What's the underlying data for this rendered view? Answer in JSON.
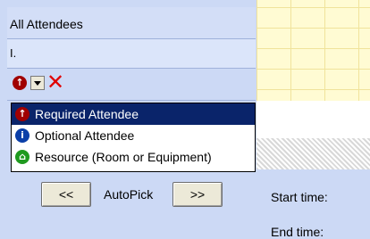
{
  "attendee_list": {
    "header": "All Attendees",
    "rows": [
      {
        "name": "I."
      }
    ]
  },
  "attendee_type_menu": {
    "items": [
      {
        "label": "Required Attendee",
        "icon": "required-attendee-icon",
        "selected": true
      },
      {
        "label": "Optional Attendee",
        "icon": "optional-attendee-icon",
        "selected": false
      },
      {
        "label": "Resource (Room or Equipment)",
        "icon": "resource-icon",
        "selected": false
      }
    ]
  },
  "autopick": {
    "prev_label": "<<",
    "label": "AutoPick",
    "next_label": ">>"
  },
  "times": {
    "start_label": "Start time:",
    "end_label": "End time:"
  },
  "colors": {
    "panel_bg": "#ccd9f5",
    "grid_bg": "#fffbd3",
    "selection": "#0a246a",
    "required": "#a00000",
    "optional": "#0b3fa8",
    "resource": "#1f9a1f",
    "remove": "#e00000"
  }
}
